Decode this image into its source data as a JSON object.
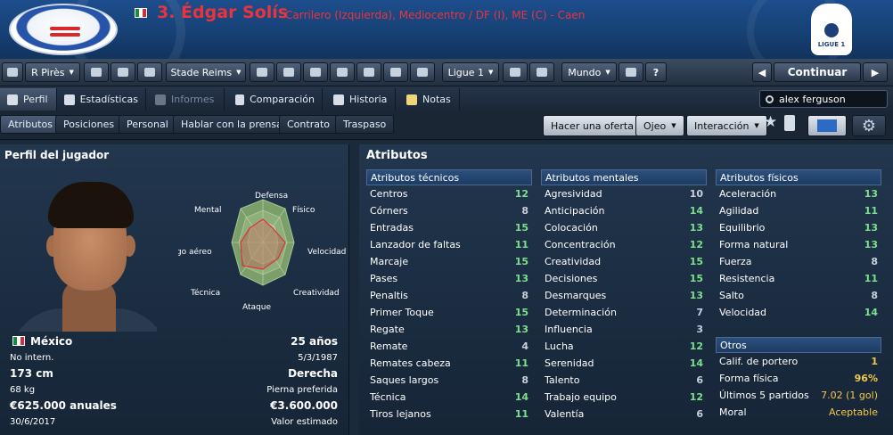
{
  "header": {
    "player_name": "3. Édgar Solís",
    "position_club": "Carrilero (Izquierda), Mediocentro / DF (I), ME (C) - Caen",
    "league_logo_text": "LIGUE 1",
    "flag_colors": [
      "#1a8a3c",
      "#ffffff",
      "#d0303a"
    ],
    "name_color": "#e8353d"
  },
  "toolbar": {
    "home": "home-icon",
    "manager": "R Pirès",
    "next_opponent": "Stade Reims",
    "league": "Ligue 1",
    "world": "Mundo",
    "help": "?",
    "continue_label": "Continuar"
  },
  "tabs": [
    {
      "label": "Perfil"
    },
    {
      "label": "Estadísticas"
    },
    {
      "label": "Informes"
    },
    {
      "label": "Comparación"
    },
    {
      "label": "Historia"
    },
    {
      "label": "Notas"
    }
  ],
  "search": {
    "value": "alex ferguson"
  },
  "subnav": [
    {
      "label": "Atributos"
    },
    {
      "label": "Posiciones"
    },
    {
      "label": "Personal"
    },
    {
      "label": "Hablar con la prensa"
    },
    {
      "label": "Contrato"
    },
    {
      "label": "Traspaso"
    }
  ],
  "actions": {
    "offer": "Hacer una oferta",
    "scout": "Ojeo",
    "interaction": "Interacción"
  },
  "profile": {
    "title": "Perfil del jugador",
    "radar_labels": [
      "Defensa",
      "Físico",
      "Velocidad",
      "Creatividad",
      "Ataque",
      "Técnica",
      "Juego aéreo",
      "Mental"
    ],
    "nationality": "México",
    "caps": "No intern.",
    "height": "173 cm",
    "weight": "68 kg",
    "wage": "€625.000 anuales",
    "contract_end": "30/6/2017",
    "age": "25 años",
    "birth_date": "5/3/1987",
    "foot": "Derecha",
    "foot_label": "Pierna preferida",
    "value": "€3.600.000",
    "value_label": "Valor estimado"
  },
  "attributes": {
    "title": "Atributos",
    "technical": {
      "title": "Atributos técnicos",
      "items": [
        {
          "name": "Centros",
          "value": "12"
        },
        {
          "name": "Córners",
          "value": "8"
        },
        {
          "name": "Entradas",
          "value": "15"
        },
        {
          "name": "Lanzador de faltas",
          "value": "11"
        },
        {
          "name": "Marcaje",
          "value": "15"
        },
        {
          "name": "Pases",
          "value": "13"
        },
        {
          "name": "Penaltis",
          "value": "8"
        },
        {
          "name": "Primer Toque",
          "value": "15"
        },
        {
          "name": "Regate",
          "value": "13"
        },
        {
          "name": "Remate",
          "value": "4"
        },
        {
          "name": "Remates cabeza",
          "value": "11"
        },
        {
          "name": "Saques largos",
          "value": "8"
        },
        {
          "name": "Técnica",
          "value": "14"
        },
        {
          "name": "Tiros lejanos",
          "value": "11"
        }
      ]
    },
    "mental": {
      "title": "Atributos mentales",
      "items": [
        {
          "name": "Agresividad",
          "value": "10"
        },
        {
          "name": "Anticipación",
          "value": "14"
        },
        {
          "name": "Colocación",
          "value": "13"
        },
        {
          "name": "Concentración",
          "value": "12"
        },
        {
          "name": "Creatividad",
          "value": "15"
        },
        {
          "name": "Decisiones",
          "value": "15"
        },
        {
          "name": "Desmarques",
          "value": "13"
        },
        {
          "name": "Determinación",
          "value": "7"
        },
        {
          "name": "Influencia",
          "value": "3"
        },
        {
          "name": "Lucha",
          "value": "12"
        },
        {
          "name": "Serenidad",
          "value": "14"
        },
        {
          "name": "Talento",
          "value": "6"
        },
        {
          "name": "Trabajo equipo",
          "value": "12"
        },
        {
          "name": "Valentía",
          "value": "6"
        }
      ]
    },
    "physical": {
      "title": "Atributos físicos",
      "items": [
        {
          "name": "Aceleración",
          "value": "13"
        },
        {
          "name": "Agilidad",
          "value": "11"
        },
        {
          "name": "Equilibrio",
          "value": "13"
        },
        {
          "name": "Forma natural",
          "value": "13"
        },
        {
          "name": "Fuerza",
          "value": "8"
        },
        {
          "name": "Resistencia",
          "value": "11"
        },
        {
          "name": "Salto",
          "value": "8"
        },
        {
          "name": "Velocidad",
          "value": "14"
        }
      ]
    },
    "other": {
      "title": "Otros",
      "items": [
        {
          "name": "Calif. de portero",
          "value": "1"
        },
        {
          "name": "Forma física",
          "value": "96%"
        },
        {
          "name": "Últimos 5 partidos",
          "value": "7.02 (1 gol)"
        },
        {
          "name": "Moral",
          "value": "Aceptable"
        }
      ]
    }
  },
  "colors": {
    "high": "#7de08d",
    "low": "#c8d0da",
    "gold": "#f2c84b"
  }
}
